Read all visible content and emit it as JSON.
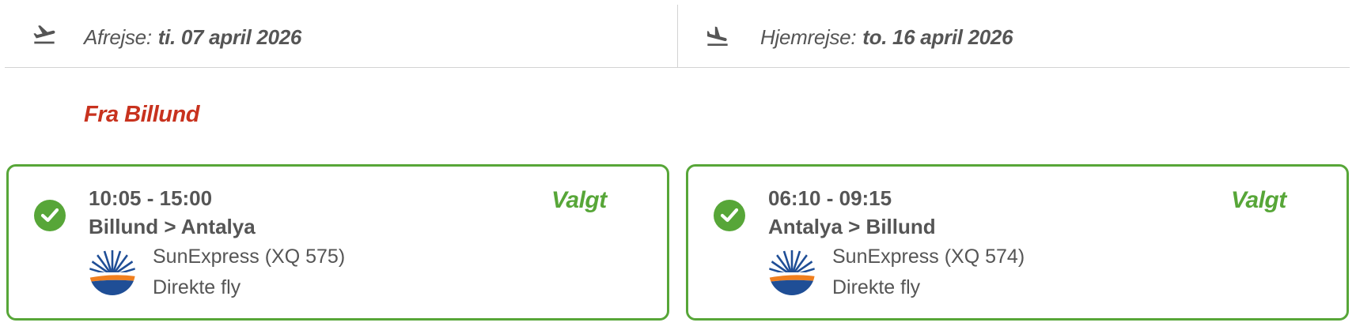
{
  "header": {
    "departure": {
      "label": "Afrejse:",
      "date": "ti. 07 april 2026",
      "icon": "plane-takeoff-icon"
    },
    "return": {
      "label": "Hjemrejse:",
      "date": "to. 16 april 2026",
      "icon": "plane-landing-icon"
    }
  },
  "section_title": "Fra Billund",
  "flights": [
    {
      "time": "10:05 - 15:00",
      "route": "Billund > Antalya",
      "airline": "SunExpress (XQ 575)",
      "type": "Direkte fly",
      "status": "Valgt"
    },
    {
      "time": "06:10 - 09:15",
      "route": "Antalya > Billund",
      "airline": "SunExpress (XQ 574)",
      "type": "Direkte fly",
      "status": "Valgt"
    }
  ],
  "colors": {
    "accent_green": "#57a638",
    "title_red": "#c8321e",
    "text": "#555555",
    "divider": "#d3d3d3"
  }
}
